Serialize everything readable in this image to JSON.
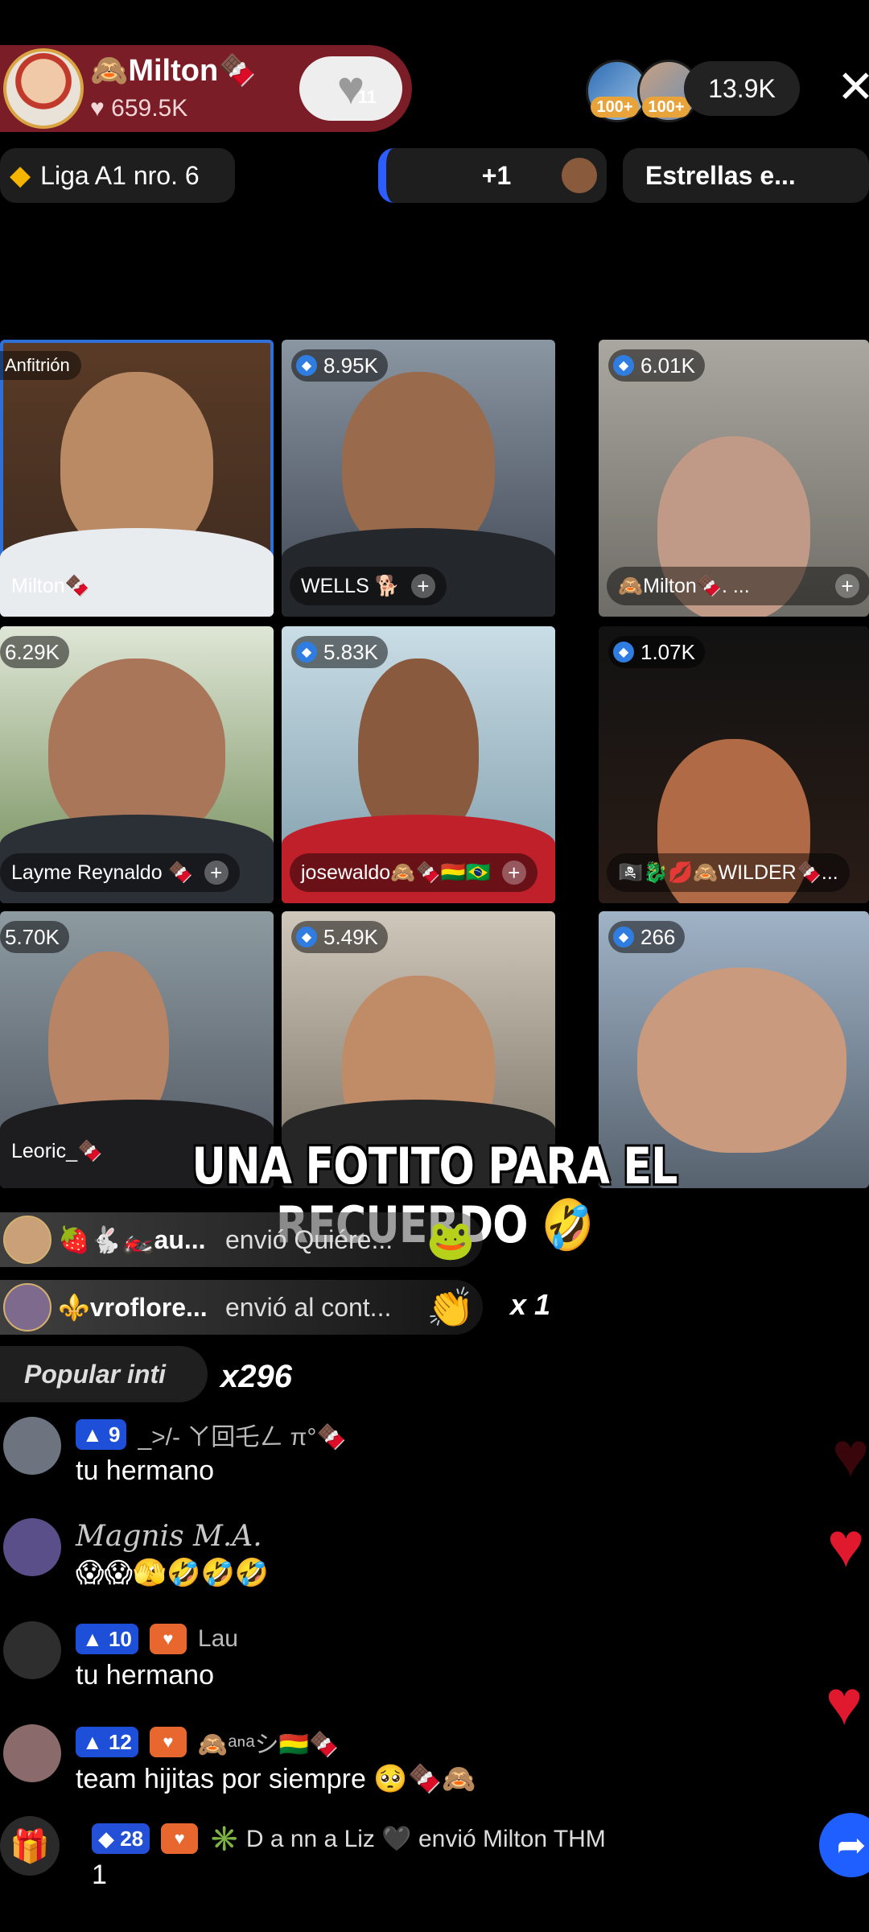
{
  "header": {
    "host_name": "🙈Milton🍫",
    "host_likes": "♥ 659.5K",
    "follow_count": "11",
    "viewer_badges": [
      "100+",
      "100+"
    ],
    "viewer_count": "13.9K"
  },
  "pills": {
    "rank": "Liga A1 nro. 6",
    "plus": "+1",
    "stars": "Estrellas e..."
  },
  "grid": {
    "host_label": "Anfitrión",
    "tiles": [
      {
        "score": "",
        "name": "Milton🍫"
      },
      {
        "score": "8.95K",
        "name": "WELLS 🐕"
      },
      {
        "score": "6.01K",
        "name": "🙈Milton🍫.        ..."
      },
      {
        "score": "6.29K",
        "name": "Layme Reynaldo 🍫"
      },
      {
        "score": "5.83K",
        "name": "josewaldo🙈🍫🇧🇴🇧🇷"
      },
      {
        "score": "1.07K",
        "name": "🏴‍☠️🐉💋🙈WILDER🍫..."
      },
      {
        "score": "5.70K",
        "name": "Leoric_🍫"
      },
      {
        "score": "5.49K",
        "name": ""
      },
      {
        "score": "266",
        "name": ""
      }
    ]
  },
  "caption": "UNA FOTITO PARA EL RECUERDO 🤣",
  "gifts": [
    {
      "who": "🍓🐇🏍️au...",
      "what": "envió Quiére...",
      "gift": "🐸",
      "combo": ""
    },
    {
      "who": "⚜️vroflore...",
      "what": "envió al cont...",
      "gift": "👏",
      "combo": "x 1"
    }
  ],
  "popular": {
    "label": "Popular inti",
    "combo": "x296"
  },
  "comments": [
    {
      "level": "9",
      "name": "_>/- ㄚ回乇ㄥ π°🍫",
      "text": "tu hermano",
      "fan": false,
      "script": false
    },
    {
      "level": "",
      "name": "Magnis M.A.",
      "text": "😱😱🫣🤣🤣🤣",
      "fan": false,
      "script": true
    },
    {
      "level": "10",
      "name": "Lau",
      "text": "tu hermano",
      "fan": true,
      "script": false
    },
    {
      "level": "12",
      "name": "🙈ᵃⁿᵃシ🇧🇴🍫",
      "text": "team hijitas por siempre 🥺🍫🙈",
      "fan": true,
      "script": false
    },
    {
      "level": "28",
      "name": "✳️ D a nn a Liz 🖤 envió Milton THM",
      "text": "1",
      "fan": true,
      "script": false
    }
  ],
  "colors": {
    "accent": "#7a1d26",
    "level_badge": "#1d4fd8",
    "heart": "#e0192e"
  }
}
